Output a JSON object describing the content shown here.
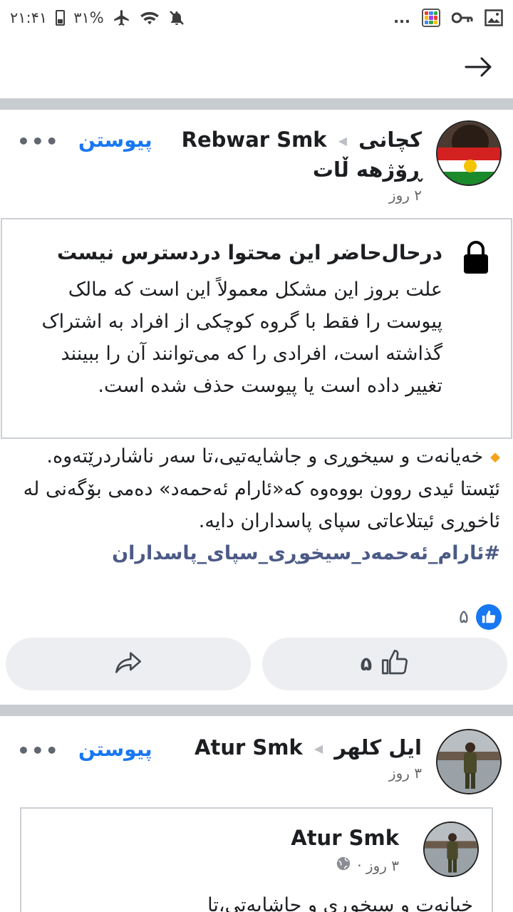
{
  "status_bar": {
    "time": "۲۱:۴۱",
    "battery": "۳۱%",
    "overflow": "..."
  },
  "post1": {
    "group_name": "کچانی",
    "author": "Rebwar Smk",
    "group_name_2": "ڕۆژهه ڵات",
    "time": "۲ روز",
    "join_label": "پیوستن",
    "more_label": "•••",
    "unavailable_title": "درحال‌حاضر این محتوا دردسترس نیست",
    "unavailable_body": "علت بروز این مشکل معمولاً این است که مالک پیوست را فقط با گروه کوچکی از افراد به اشتراک گذاشته است، افرادی را که می‌توانند آن را ببینند تغییر داده است یا پیوست حذف شده است.",
    "text_line1": "خەیانەت و سیخوڕی و جاشایەتیی،تا سەر ناشاردرێتەوە.",
    "text_line2": "ئێستا ئیدی روون بووەوە کە«ئارام ئەحمەد» دەمی بۆگەنی لە ئاخوڕی ئیتلاعاتی سپای پاسداران دایە.",
    "hashtag": "#ئارام_ئەحمەد_سیخوڕی_سپای_پاسداران",
    "reaction_count": "۵",
    "like_count": "۵"
  },
  "post2": {
    "group_name": "ایل کلهر",
    "author": "Atur Smk",
    "time": "۳ روز",
    "join_label": "پیوستن",
    "more_label": "•••",
    "shared_author": "Atur Smk",
    "shared_time": "۳ روز ·",
    "shared_text_partial": "خیانه‌ت و سیخوڕی و جاشایه‌تی،تا"
  },
  "colors": {
    "accent": "#1877f2",
    "divider": "#c9ccd1",
    "button_bg": "#eceef2",
    "hashtag": "#4b5a86",
    "diamond": "#f7a21b"
  }
}
